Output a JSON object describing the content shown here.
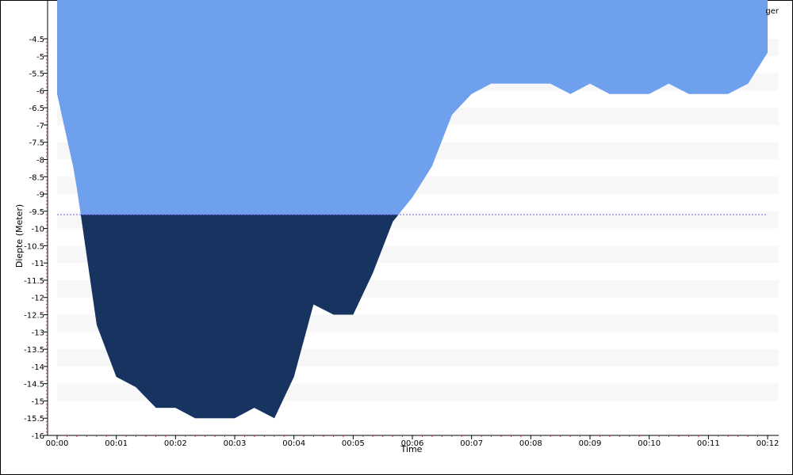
{
  "legend": {
    "text": "ger"
  },
  "chart_data": {
    "type": "area",
    "title": "",
    "xlabel": "Time",
    "ylabel": "Diepte (Meter)",
    "xlim": [
      0,
      12
    ],
    "ylim": [
      -16,
      -4.5
    ],
    "x_tick_labels": [
      "00:00",
      "00:01",
      "00:02",
      "00:03",
      "00:04",
      "00:05",
      "00:06",
      "00:07",
      "00:08",
      "00:09",
      "00:10",
      "00:11",
      "00:12"
    ],
    "y_tick_labels": [
      "-4.5",
      "-5",
      "-5.5",
      "-6",
      "-6.5",
      "-7",
      "-7.5",
      "-8",
      "-8.5",
      "-9",
      "-9.5",
      "-10",
      "-10.5",
      "-11",
      "-11.5",
      "-12",
      "-12.5",
      "-13",
      "-13.5",
      "-14",
      "-14.5",
      "-15",
      "-15.5",
      "-16"
    ],
    "threshold": -9.6,
    "grid": "horizontal bands",
    "series": [
      {
        "x": [
          0,
          0.27,
          0.33,
          0.4,
          0.67,
          1.0,
          1.33,
          1.67,
          2.0,
          2.33,
          2.67,
          3.0,
          3.33,
          3.67,
          4.0,
          4.33,
          4.67,
          5.0,
          5.33,
          5.67,
          6.0,
          6.33,
          6.67,
          7.0,
          7.33,
          7.67,
          8.0,
          8.33,
          8.67,
          9.0,
          9.33,
          9.67,
          10.0,
          10.33,
          10.67,
          11.0,
          11.33,
          11.67,
          12.0
        ],
        "values": [
          -6.1,
          -8.2,
          -8.8,
          -9.6,
          -12.8,
          -14.3,
          -14.6,
          -15.2,
          -15.2,
          -15.5,
          -15.5,
          -15.5,
          -15.2,
          -15.5,
          -14.3,
          -12.2,
          -12.5,
          -12.5,
          -11.3,
          -9.8,
          -9.1,
          -8.2,
          -6.7,
          -6.1,
          -5.8,
          -5.8,
          -5.8,
          -5.8,
          -6.1,
          -5.8,
          -6.1,
          -6.1,
          -6.1,
          -5.8,
          -6.1,
          -6.1,
          -6.1,
          -5.8,
          -4.9
        ]
      }
    ],
    "colors": {
      "above_threshold": "#6fa0ee",
      "below_threshold": "#17335f",
      "threshold_line": "#7b68ee",
      "band": "#f7f7f7",
      "axis_ticks": "#c03060"
    }
  }
}
